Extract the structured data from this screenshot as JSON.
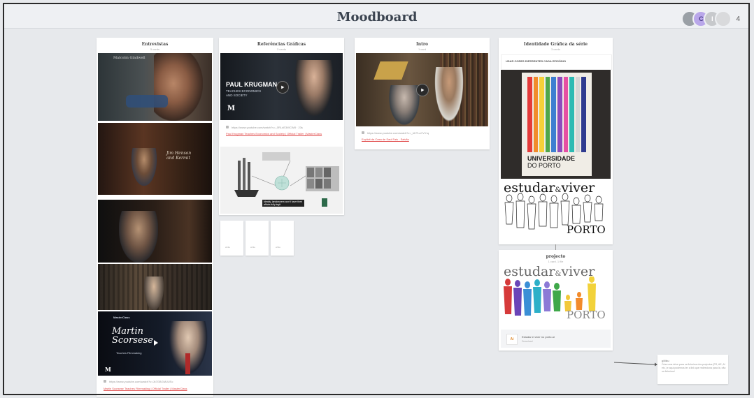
{
  "app": {
    "title": "Moodboard",
    "collaborators_count": "4",
    "avatar_initials": [
      "",
      "C",
      "I",
      ""
    ]
  },
  "columns": [
    {
      "title": "Entrevistas",
      "subtitle": "5 cards"
    },
    {
      "title": "Referências Gráficas",
      "subtitle": "3 cards"
    },
    {
      "title": "Intro",
      "subtitle": "1 card"
    },
    {
      "title": "Identidade Gráfica da série",
      "subtitle": "3 cards"
    },
    {
      "title": "projecto",
      "subtitle": "1 card, 1 file"
    }
  ],
  "entrevistas": {
    "thumbs": [
      {
        "overlay": "Malcolm Gladwell"
      },
      {
        "overlay": "Jim Henson \n and Kermit"
      },
      {
        "overlay": ""
      },
      {
        "overlay": ""
      },
      {
        "overlay_top": "MasterClass",
        "overlay_title": "Martin\nScorsese",
        "overlay_sub": "Teaches Filmmaking",
        "logo": "M"
      }
    ],
    "link": {
      "meta": "https://www.youtube.com/watch?v=Jk7GBGMUUSc",
      "title": "Martin Scorsese Teaches Filmmaking | Official Trailer | MasterClass"
    }
  },
  "referencias": {
    "video1": {
      "overlay_title": "PAUL KRUGMAN",
      "overlay_sub": "TEACHES ECONOMICS\nAND SOCIETY",
      "logo": "M"
    },
    "link": {
      "meta": "https://www.youtube.com/watch?v=_0RLdE3WCW8 · 23s",
      "title": "Paul Krugman Teaches Economics and Society | Official Trailer | MasterClass"
    },
    "infographic_caption": "Ideally, landowners won't have their affairs fully legit",
    "mini_cards": [
      {
        "label": "white"
      },
      {
        "label": "white"
      },
      {
        "label": "white"
      }
    ]
  },
  "intro": {
    "link": {
      "meta": "https://www.youtube.com/watch?v=_bKTLaYVYrq",
      "title": "Explicit da Casa de Saul Fais - Salvão"
    }
  },
  "identidade": {
    "header_note": "USAR CORES DIFERENTES CADA EPISÓDIO",
    "book_text_1": "UNIVERSIDADE",
    "book_text_2": "DO PORTO",
    "logo_line1": "estudar",
    "logo_amp": "&",
    "logo_line2": "viver",
    "logo_city": "PORTO",
    "stripe_colors": [
      "#e53b3b",
      "#f18b2c",
      "#f6d03a",
      "#4fa64c",
      "#3e7fd1",
      "#8e4bbd",
      "#e64fa3",
      "#2dbab3",
      "#d6d6d6",
      "#2f3b8f"
    ]
  },
  "projecto": {
    "logo_line1": "estudar",
    "logo_amp": "&",
    "logo_line2": "viver",
    "logo_city": "PORTO",
    "file": {
      "icon": "Ai",
      "name": "Estudar e viver no porto.ai",
      "meta": "Download"
    }
  },
  "note": {
    "title": "gliibu",
    "text": "Criar uma drive para os ficheiros dos projectos (PS, AE, AI etc.) e aqui podemos ter a link que redireciona para lá, não os ficheiros!"
  },
  "colors": {
    "accent": "#e04848",
    "board_bg": "#e7e9ec",
    "title": "#3b4450"
  }
}
